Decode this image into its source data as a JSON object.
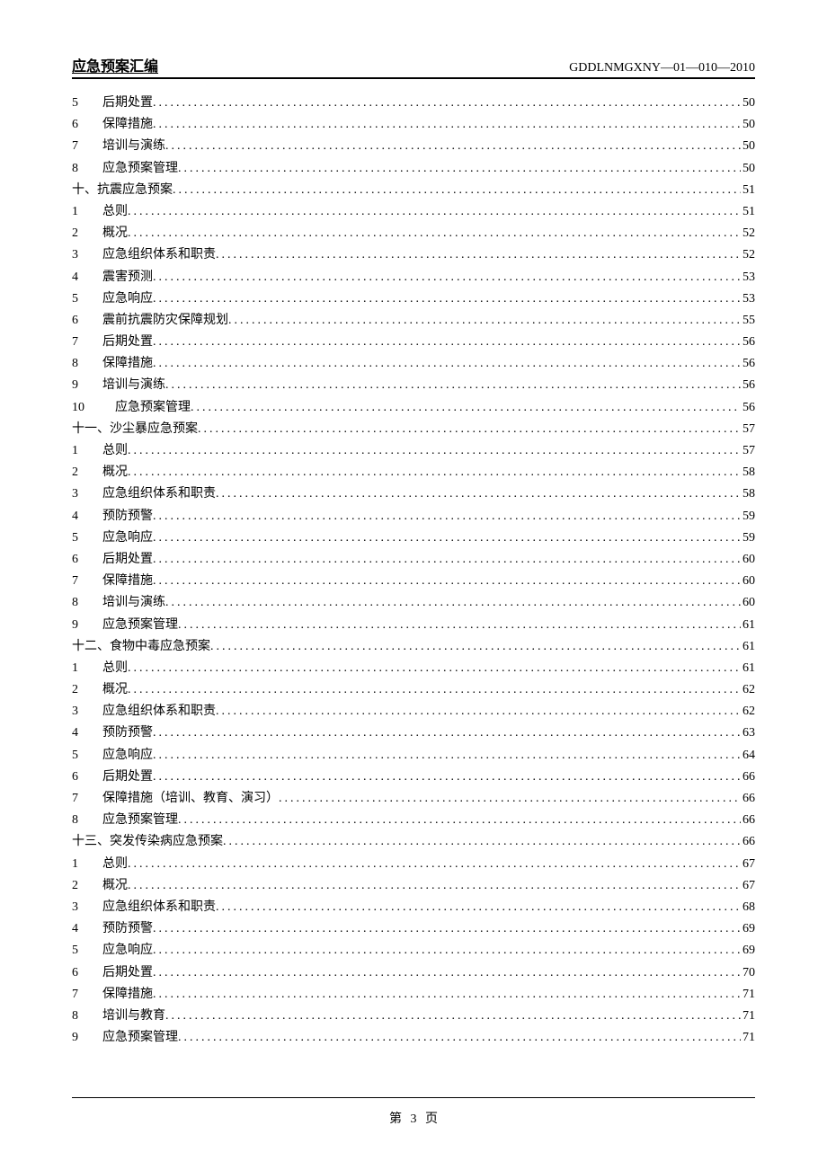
{
  "header": {
    "left": "应急预案汇编",
    "right": "GDDLNMGXNY—01—010—2010"
  },
  "toc": [
    {
      "num": "5",
      "title": "后期处置",
      "page": "50",
      "section": false
    },
    {
      "num": "6",
      "title": "保障措施",
      "page": "50",
      "section": false
    },
    {
      "num": "7",
      "title": "培训与演练",
      "page": "50",
      "section": false
    },
    {
      "num": "8",
      "title": "应急预案管理",
      "page": "50",
      "section": false
    },
    {
      "num": "十、",
      "title": "抗震应急预案",
      "page": "51",
      "section": true
    },
    {
      "num": "1",
      "title": "总则",
      "page": "51",
      "section": false
    },
    {
      "num": "2",
      "title": "概况",
      "page": "52",
      "section": false
    },
    {
      "num": "3",
      "title": "应急组织体系和职责",
      "page": "52",
      "section": false
    },
    {
      "num": "4",
      "title": "震害预测",
      "page": "53",
      "section": false
    },
    {
      "num": "5",
      "title": "应急响应",
      "page": "53",
      "section": false
    },
    {
      "num": "6",
      "title": "震前抗震防灾保障规划",
      "page": "55",
      "section": false
    },
    {
      "num": "7",
      "title": "后期处置",
      "page": "56",
      "section": false
    },
    {
      "num": "8",
      "title": "保障措施",
      "page": "56",
      "section": false
    },
    {
      "num": "9",
      "title": "培训与演练",
      "page": "56",
      "section": false
    },
    {
      "num": "10",
      "title": "应急预案管理",
      "page": "56",
      "section": false,
      "wide": true
    },
    {
      "num": "十一、",
      "title": "沙尘暴应急预案",
      "page": "57",
      "section": true
    },
    {
      "num": "1",
      "title": "总则",
      "page": "57",
      "section": false
    },
    {
      "num": "2",
      "title": "概况",
      "page": "58",
      "section": false
    },
    {
      "num": "3",
      "title": "应急组织体系和职责",
      "page": "58",
      "section": false
    },
    {
      "num": "4",
      "title": "预防预警",
      "page": "59",
      "section": false
    },
    {
      "num": "5",
      "title": "应急响应",
      "page": "59",
      "section": false
    },
    {
      "num": "6",
      "title": "后期处置",
      "page": "60",
      "section": false
    },
    {
      "num": "7",
      "title": "保障措施",
      "page": "60",
      "section": false
    },
    {
      "num": "8",
      "title": "培训与演练",
      "page": "60",
      "section": false
    },
    {
      "num": "9",
      "title": "应急预案管理",
      "page": "61",
      "section": false
    },
    {
      "num": "十二、",
      "title": "食物中毒应急预案",
      "page": "61",
      "section": true
    },
    {
      "num": "1",
      "title": "总则",
      "page": "61",
      "section": false
    },
    {
      "num": "2",
      "title": "概况",
      "page": "62",
      "section": false
    },
    {
      "num": "3",
      "title": "应急组织体系和职责",
      "page": "62",
      "section": false
    },
    {
      "num": "4",
      "title": "预防预警",
      "page": "63",
      "section": false
    },
    {
      "num": "5",
      "title": "应急响应",
      "page": "64",
      "section": false
    },
    {
      "num": "6",
      "title": "后期处置",
      "page": "66",
      "section": false
    },
    {
      "num": "7",
      "title": "保障措施（培训、教育、演习）",
      "page": "66",
      "section": false
    },
    {
      "num": "8",
      "title": "应急预案管理",
      "page": "66",
      "section": false
    },
    {
      "num": "十三、",
      "title": "突发传染病应急预案",
      "page": "66",
      "section": true
    },
    {
      "num": "1",
      "title": "总则",
      "page": "67",
      "section": false
    },
    {
      "num": "2",
      "title": "概况",
      "page": "67",
      "section": false
    },
    {
      "num": "3",
      "title": "应急组织体系和职责",
      "page": "68",
      "section": false
    },
    {
      "num": "4",
      "title": "预防预警",
      "page": "69",
      "section": false
    },
    {
      "num": "5",
      "title": "应急响应",
      "page": "69",
      "section": false
    },
    {
      "num": "6",
      "title": "后期处置",
      "page": "70",
      "section": false
    },
    {
      "num": "7",
      "title": "保障措施",
      "page": "71",
      "section": false
    },
    {
      "num": "8",
      "title": "培训与教育",
      "page": "71",
      "section": false
    },
    {
      "num": "9",
      "title": "应急预案管理",
      "page": "71",
      "section": false
    }
  ],
  "footer": {
    "prefix": "第",
    "page": "3",
    "suffix": "页"
  }
}
